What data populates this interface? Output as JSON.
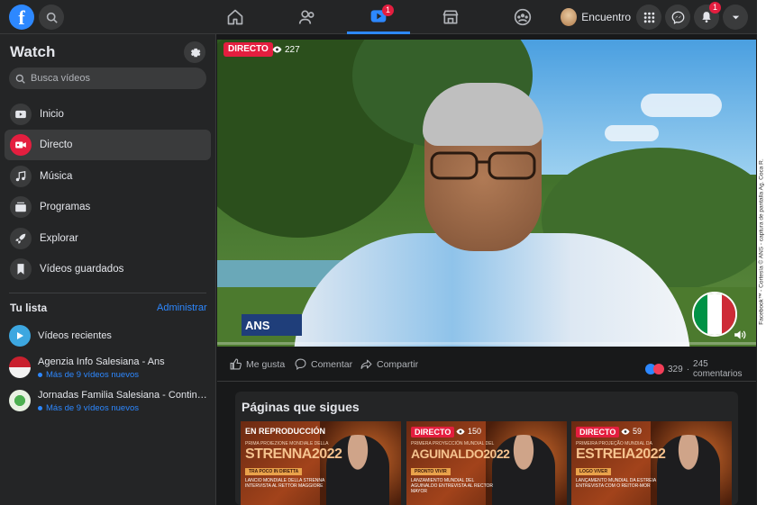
{
  "topbar": {
    "logo_letter": "f",
    "profile_name": "Encuentro",
    "watch_badge": "1",
    "notifications_badge": "1"
  },
  "sidebar": {
    "title": "Watch",
    "search_placeholder": "Busca vídeos",
    "items": [
      {
        "label": "Inicio",
        "icon": "play-icon"
      },
      {
        "label": "Directo",
        "icon": "live-icon"
      },
      {
        "label": "Música",
        "icon": "music-icon"
      },
      {
        "label": "Programas",
        "icon": "shows-icon"
      },
      {
        "label": "Explorar",
        "icon": "rocket-icon"
      },
      {
        "label": "Vídeos guardados",
        "icon": "bookmark-icon"
      }
    ],
    "list_title": "Tu lista",
    "list_admin": "Administrar",
    "list": [
      {
        "name": "Vídeos recientes",
        "sub": ""
      },
      {
        "name": "Agenzia Info Salesiana - Ans",
        "sub": "Más de 9 vídeos nuevos"
      },
      {
        "name": "Jornadas Familia Salesiana - Continen…",
        "sub": "Más de 9 vídeos nuevos"
      }
    ]
  },
  "video": {
    "live_label": "DIRECTO",
    "viewers": "227",
    "logo_text": "ANS",
    "accent": "#e41e3f"
  },
  "actions": {
    "like": "Me gusta",
    "comment": "Comentar",
    "share": "Compartir",
    "reaction_count": "329",
    "separator": "·",
    "comments": "245 comentarios"
  },
  "pages": {
    "title": "Páginas que sigues",
    "thumbs": [
      {
        "status": "EN REPRODUCCIÓN",
        "live": "",
        "views": "",
        "line1": "PRIMA PROIEZIONE MONDIALE DELLA",
        "big": "STRENNA2022",
        "bar": "TRA POCO IN DIRETTA",
        "desc": "LANCIO MONDIALE DELLA STRENNA INTERVISTA AL RETTOR MAGGIORE"
      },
      {
        "status": "",
        "live": "DIRECTO",
        "views": "150",
        "line1": "PRIMERA PROYECCIÓN MUNDIAL DEL",
        "big": "AGUINALDO2022",
        "bar": "PRONTO VIVIR",
        "desc": "LANZAMIENTO MUNDIAL DEL AGUINALDO ENTREVISTA AL RECTOR MAYOR"
      },
      {
        "status": "",
        "live": "DIRECTO",
        "views": "59",
        "line1": "PRIMEIRA PROJEÇÃO MUNDIAL DA",
        "big": "ESTREIA2022",
        "bar": "LOGO VIVER",
        "desc": "LANÇAMENTO MUNDIAL DA ESTREIA ENTREVISTA COM O REITOR-MOR"
      }
    ]
  },
  "credit": "Facebook™ - Cortesía © ANS - captura de pantalla Ag. Coca R."
}
